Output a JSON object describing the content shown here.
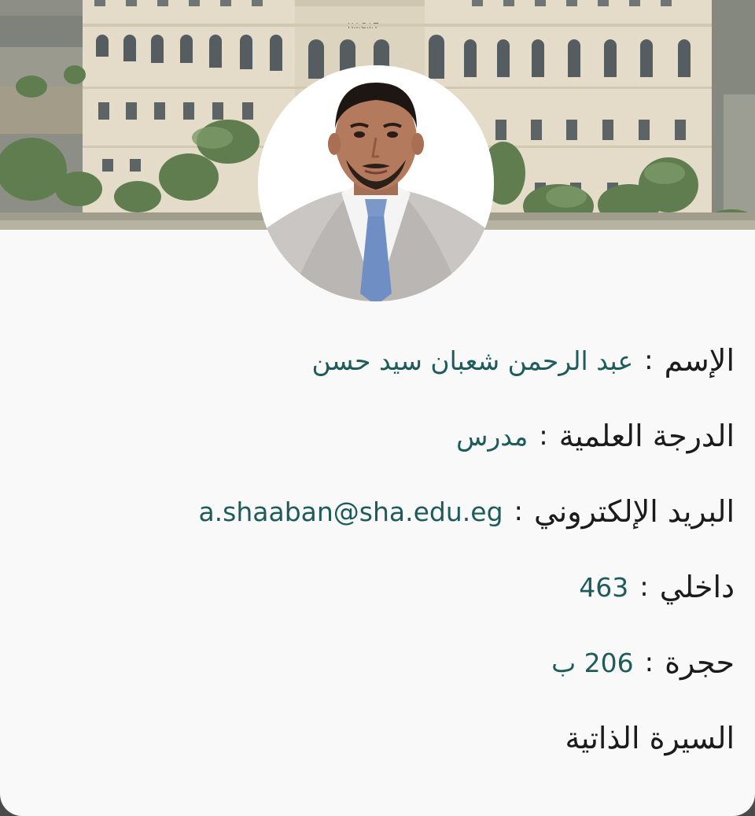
{
  "profile": {
    "name_label": "الإسم",
    "name_value": "عبد الرحمن شعبان سيد حسن",
    "degree_label": "الدرجة العلمية",
    "degree_value": "مدرس",
    "email_label": "البريد الإلكتروني",
    "email_value": "a.shaaban@sha.edu.eg",
    "ext_label": "داخلي",
    "ext_value": "463",
    "room_label": "حجرة",
    "room_value": "206 ب",
    "separator": ":",
    "cv_link": "السيرة الذاتية"
  },
  "cover": {
    "building_sign": "H.I.C.I.T"
  },
  "colors": {
    "value_text": "#1d5c5a",
    "label_text": "#1b1b1b",
    "card_bg": "#f9f9f9"
  }
}
